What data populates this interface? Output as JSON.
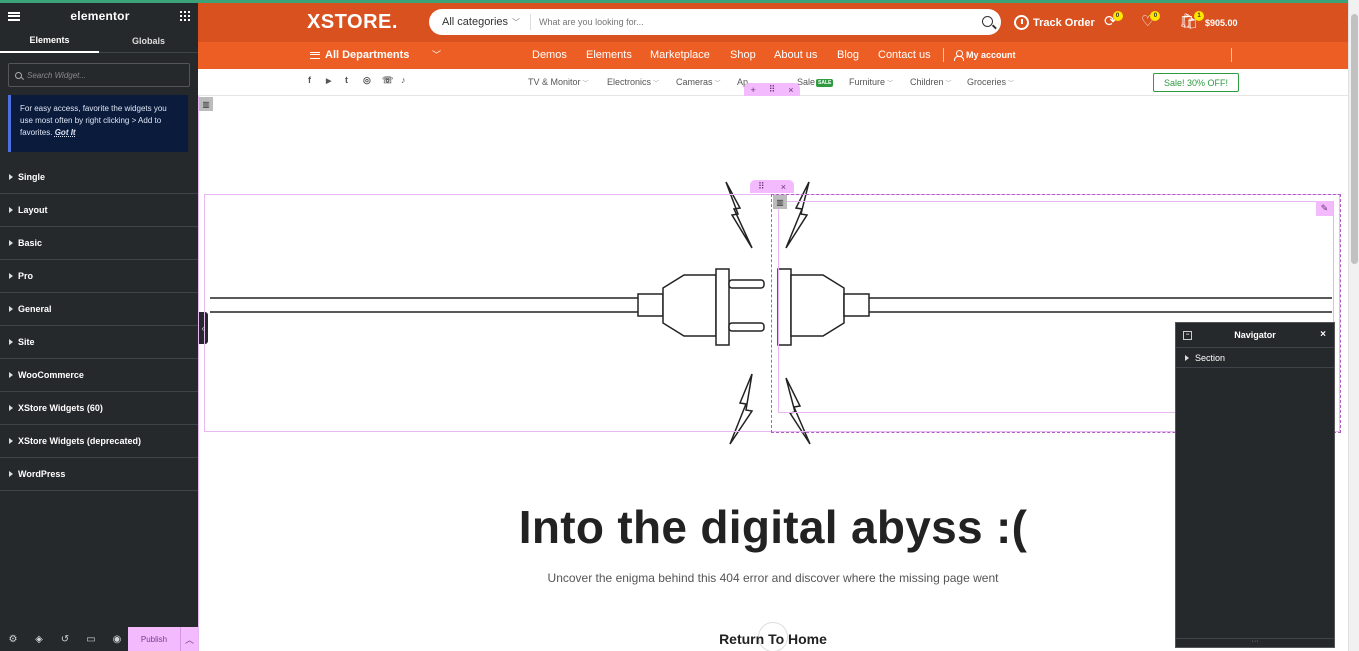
{
  "editor": {
    "logo": "elementor",
    "tabs": [
      "Elements",
      "Globals"
    ],
    "search_placeholder": "Search Widget...",
    "tip_text": "For easy access, favorite the widgets you use most often by right clicking > Add to favorites.",
    "tip_link": "Got It",
    "categories": [
      "Single",
      "Layout",
      "Basic",
      "Pro",
      "General",
      "Site",
      "WooCommerce",
      "XStore Widgets (60)",
      "XStore Widgets (deprecated)",
      "WordPress"
    ],
    "footer_icons": [
      "settings-icon",
      "layers-icon",
      "history-icon",
      "responsive-icon",
      "preview-eye-icon"
    ],
    "publish_label": "Publish"
  },
  "header": {
    "brand": "XSTORE.",
    "category_select": "All categories",
    "search_placeholder": "What are you looking for...",
    "track_order": "Track Order",
    "compare_count": "0",
    "wishlist_count": "0",
    "cart_count": "1",
    "cart_total": "$905.00"
  },
  "nav": {
    "all_departments": "All Departments",
    "links": [
      "Demos",
      "Elements",
      "Marketplace",
      "Shop",
      "About us",
      "Blog",
      "Contact us"
    ],
    "my_account": "My account"
  },
  "subnav": {
    "social": [
      "f",
      "▶",
      "t",
      "◎",
      "☏",
      "♪"
    ],
    "categories": [
      "TV & Monitor",
      "Electronics",
      "Cameras",
      "Ap",
      "Sale",
      "Furniture",
      "Children",
      "Groceries"
    ],
    "sale_badge": "SALE",
    "sale_button": "Sale! 30% OFF!"
  },
  "content": {
    "heading": "Into the digital abyss :(",
    "subtext": "Uncover the enigma behind this 404 error and discover where the missing page went",
    "return_link": "Return To Home"
  },
  "navigator": {
    "title": "Navigator",
    "items": [
      "Section"
    ]
  },
  "colors": {
    "header_bg": "#d8511f",
    "nav_bg": "#ed5e24",
    "panel_bg": "#26292c",
    "handle_pink": "#f3bafd",
    "sale_green": "#2e9b3e"
  }
}
